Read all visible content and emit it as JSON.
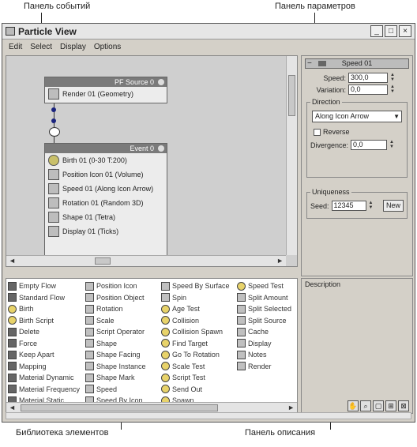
{
  "annotations": {
    "event_panel": "Панель событий",
    "param_panel": "Панель параметров",
    "library": "Библиотека элементов",
    "description": "Панель описания"
  },
  "window": {
    "title": "Particle View",
    "buttons": [
      "_",
      "□",
      "×"
    ]
  },
  "menu": [
    "Edit",
    "Select",
    "Display",
    "Options"
  ],
  "event_view": {
    "source_node": {
      "title": "PF Source 0",
      "rows": [
        {
          "label": "Render 01 (Geometry)",
          "icon": "render-icon"
        }
      ]
    },
    "event_node": {
      "title": "Event 0",
      "rows": [
        {
          "label": "Birth 01 (0-30 T:200)",
          "icon": "birth-icon"
        },
        {
          "label": "Position Icon 01 (Volume)",
          "icon": "position-icon"
        },
        {
          "label": "Speed 01 (Along Icon Arrow)",
          "icon": "speed-icon"
        },
        {
          "label": "Rotation 01 (Random 3D)",
          "icon": "rotation-icon"
        },
        {
          "label": "Shape 01 (Tetra)",
          "icon": "shape-icon"
        },
        {
          "label": "Display 01 (Ticks)",
          "icon": "display-icon"
        }
      ]
    }
  },
  "library": {
    "columns": [
      [
        "Empty Flow",
        "Standard Flow",
        "Birth",
        "Birth Script",
        "Delete",
        "Force",
        "Keep Apart",
        "Mapping",
        "Material Dynamic",
        "Material Frequency",
        "Material Static"
      ],
      [
        "Position Icon",
        "Position Object",
        "Rotation",
        "Scale",
        "Script Operator",
        "Shape",
        "Shape Facing",
        "Shape Instance",
        "Shape Mark",
        "Speed",
        "Speed By Icon"
      ],
      [
        "Speed By Surface",
        "Spin",
        "Age Test",
        "Collision",
        "Collision Spawn",
        "Find Target",
        "Go To Rotation",
        "Scale Test",
        "Script Test",
        "Send Out",
        "Spawn"
      ],
      [
        "Speed Test",
        "Split Amount",
        "Split Selected",
        "Split Source",
        "Cache",
        "Display",
        "Notes",
        "Render"
      ]
    ]
  },
  "params": {
    "rollout_title": "Speed 01",
    "speed_label": "Speed:",
    "speed_value": "300,0",
    "variation_label": "Variation:",
    "variation_value": "0,0",
    "direction_group": "Direction",
    "direction_value": "Along Icon Arrow",
    "reverse_label": "Reverse",
    "divergence_label": "Divergence:",
    "divergence_value": "0,0",
    "uniqueness_group": "Uniqueness",
    "seed_label": "Seed:",
    "seed_value": "12345",
    "new_button": "New"
  },
  "description": {
    "label": "Description"
  }
}
